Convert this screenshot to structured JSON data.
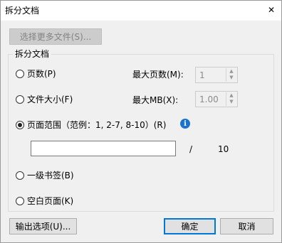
{
  "window": {
    "title": "拆分文档",
    "close_glyph": "✕"
  },
  "select_more_files_button": "选择更多文件(S)...",
  "group": {
    "legend": "拆分文档",
    "by_pages": {
      "label": "页数(P)",
      "max_label": "最大页数(M):",
      "max_value": "1",
      "selected": false
    },
    "by_size": {
      "label": "文件大小(F)",
      "max_label": "最大MB(X):",
      "max_value": "1.00",
      "selected": false
    },
    "by_range": {
      "label": "页面范围（范例：1, 2-7, 8-10）(R)",
      "selected": true,
      "range_value": "",
      "slash": "/",
      "total_pages": "10",
      "info_glyph": "i"
    },
    "by_bookmark": {
      "label": "一级书签(B)",
      "selected": false
    },
    "by_blank": {
      "label": "空白页面(K)",
      "selected": false
    }
  },
  "buttons": {
    "output_options": "输出选项(U)...",
    "ok": "确定",
    "cancel": "取消"
  },
  "icons": {
    "close": "close-icon",
    "info": "info-icon",
    "spin_up": "▲",
    "spin_down": "▼"
  }
}
